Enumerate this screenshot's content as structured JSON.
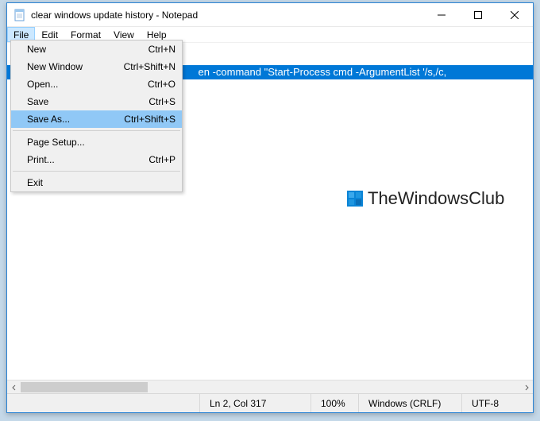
{
  "title": "clear windows update history - Notepad",
  "menubar": {
    "file": "File",
    "edit": "Edit",
    "format": "Format",
    "view": "View",
    "help": "Help"
  },
  "dropdown": {
    "new": {
      "label": "New",
      "shortcut": "Ctrl+N"
    },
    "newwindow": {
      "label": "New Window",
      "shortcut": "Ctrl+Shift+N"
    },
    "open": {
      "label": "Open...",
      "shortcut": "Ctrl+O"
    },
    "save": {
      "label": "Save",
      "shortcut": "Ctrl+S"
    },
    "saveas": {
      "label": "Save As...",
      "shortcut": "Ctrl+Shift+S"
    },
    "pagesetup": {
      "label": "Page Setup...",
      "shortcut": ""
    },
    "print": {
      "label": "Print...",
      "shortcut": "Ctrl+P"
    },
    "exit": {
      "label": "Exit",
      "shortcut": ""
    }
  },
  "editor": {
    "highlighted_tail": "en -command \"Start-Process cmd -ArgumentList '/s,/c,"
  },
  "watermark": {
    "text": "TheWindowsClub"
  },
  "status": {
    "pos": "Ln 2, Col 317",
    "zoom": "100%",
    "eol": "Windows (CRLF)",
    "enc": "UTF-8"
  }
}
